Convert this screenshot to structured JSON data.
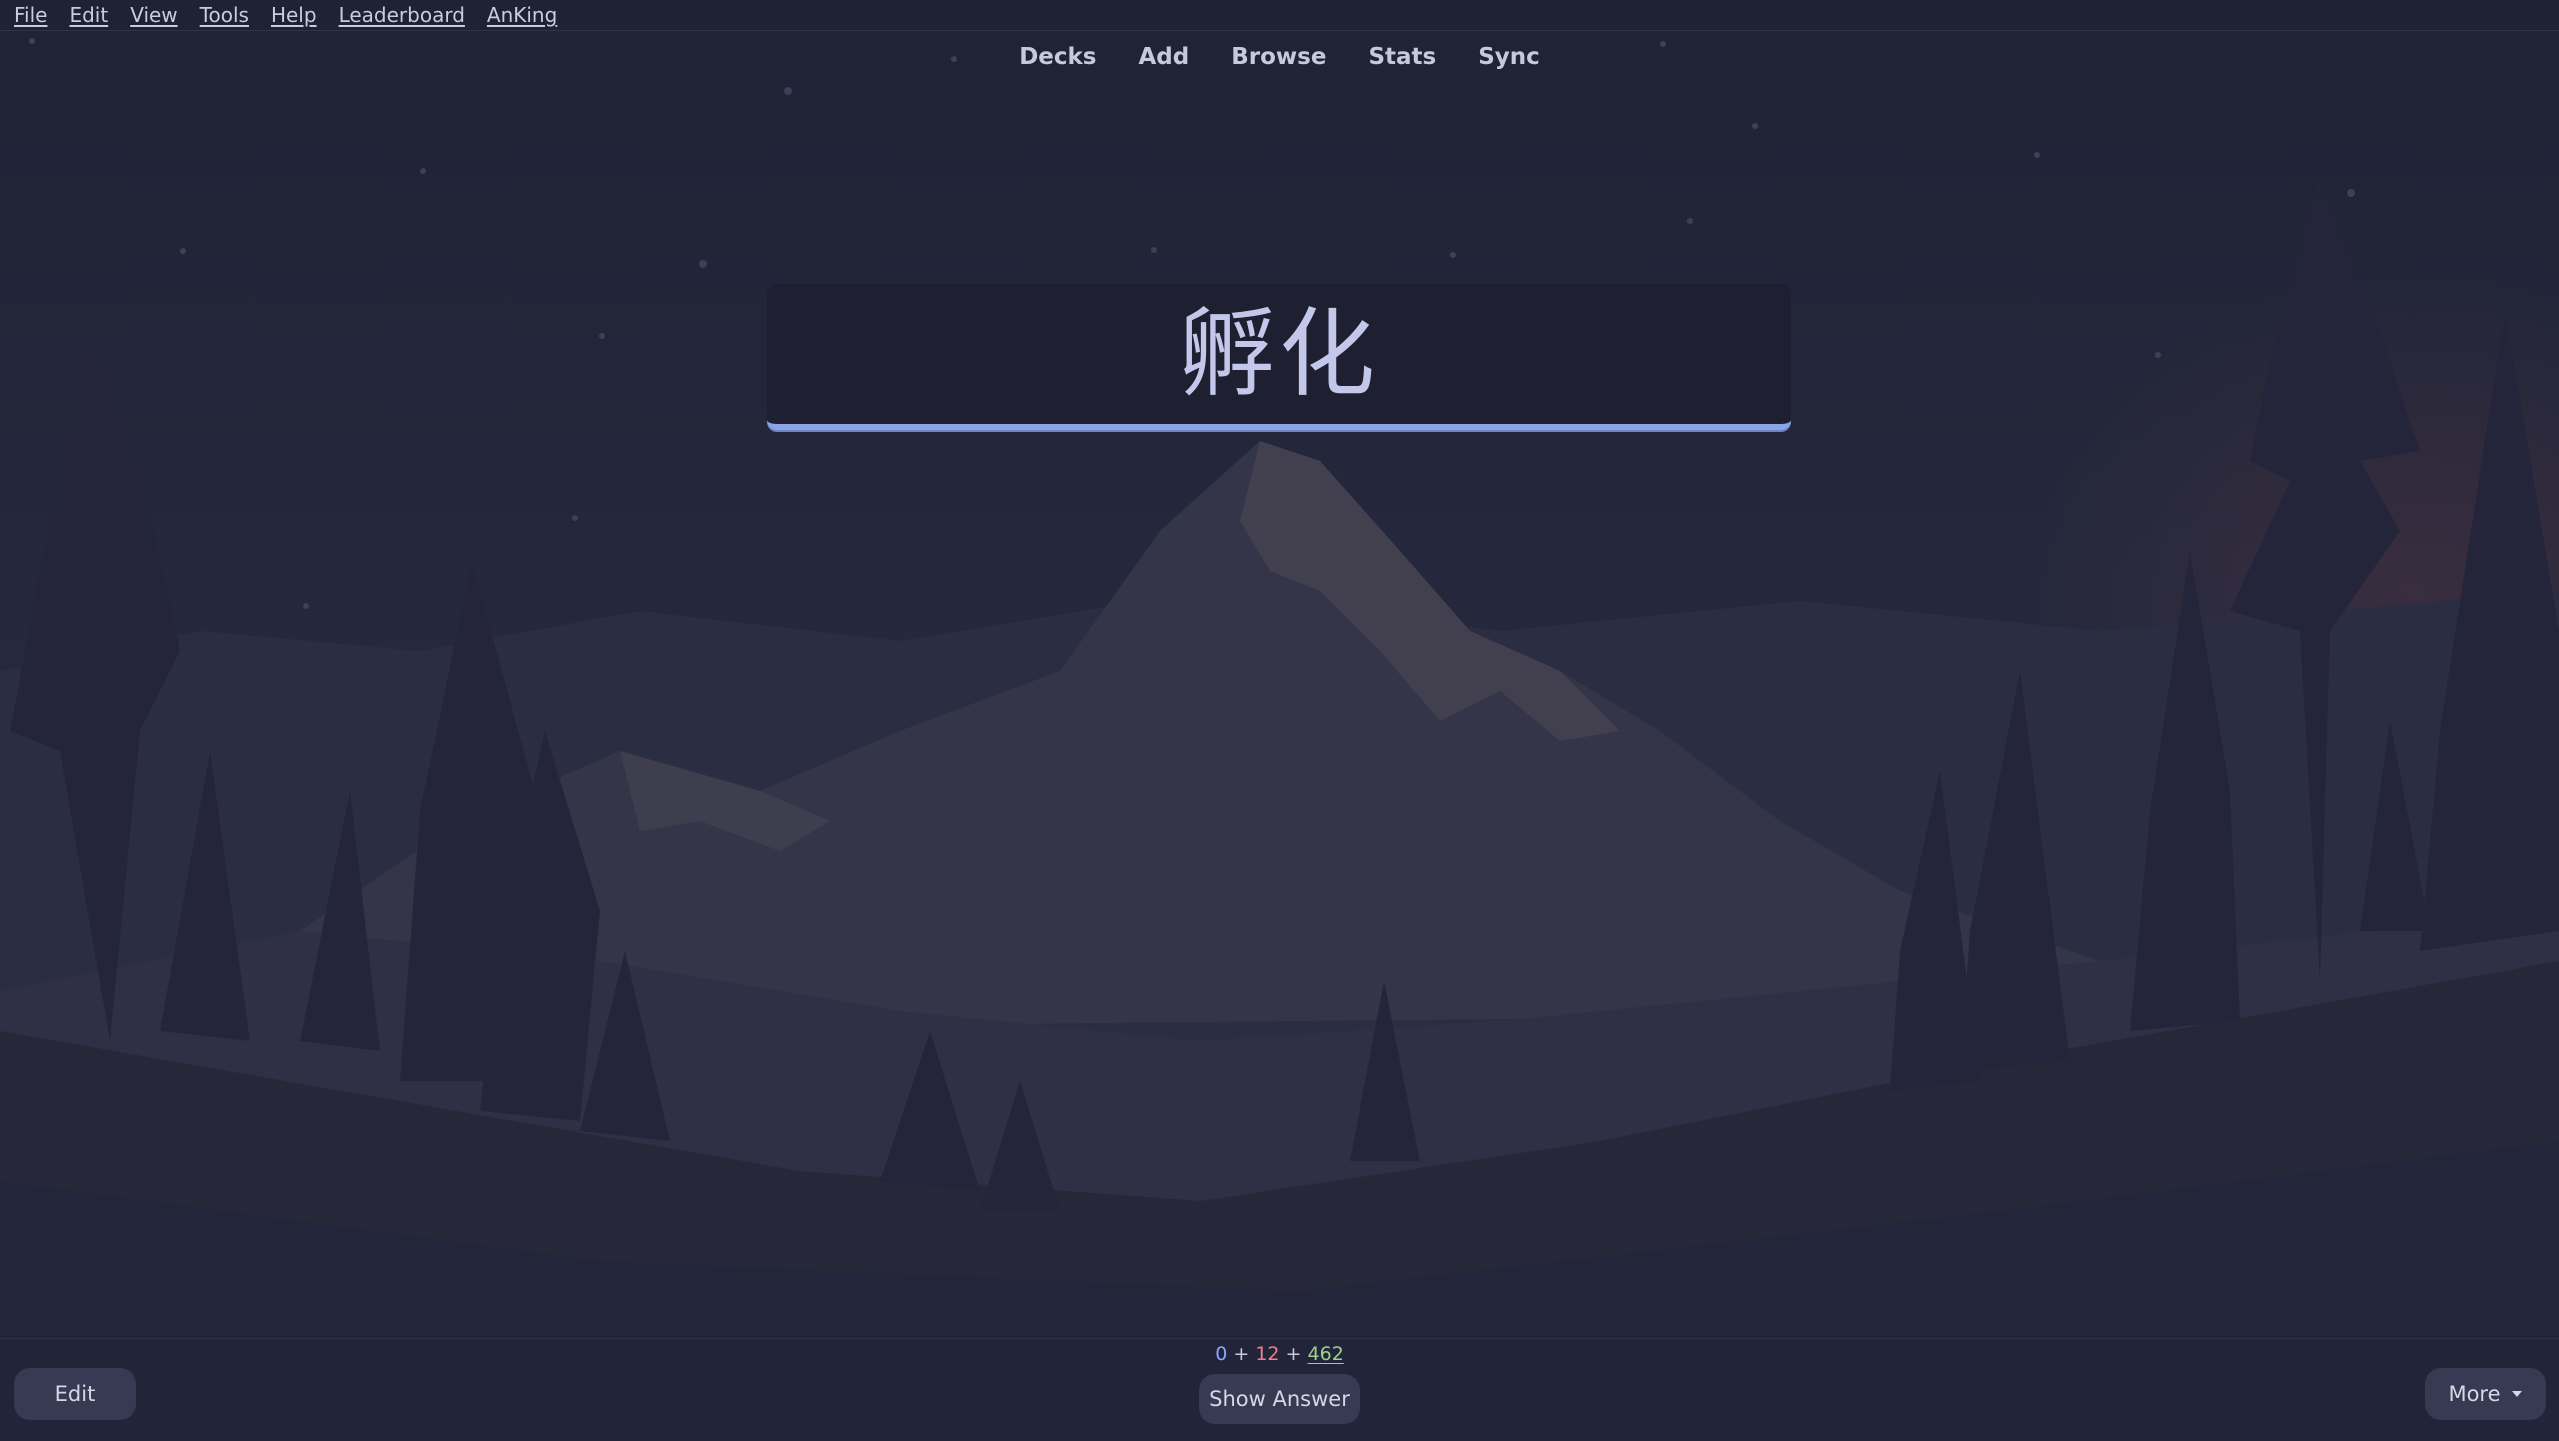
{
  "menubar": {
    "items": [
      "File",
      "Edit",
      "View",
      "Tools",
      "Help",
      "Leaderboard",
      "AnKing"
    ]
  },
  "toplinks": [
    "Decks",
    "Add",
    "Browse",
    "Stats",
    "Sync"
  ],
  "card": {
    "front": "孵化"
  },
  "bottombar": {
    "edit_label": "Edit",
    "show_answer_label": "Show Answer",
    "more_label": "More",
    "counts": {
      "new": "0",
      "learning": "12",
      "review": "462",
      "separator": "+"
    }
  },
  "colors": {
    "background": "#22253a",
    "card_underline": "#8aa4e6",
    "new_count": "#8fa3ff",
    "learning_count": "#ef7e8e",
    "review_count": "#9fd08b"
  },
  "icons": {
    "more_dropdown": "chevron-down-icon"
  }
}
